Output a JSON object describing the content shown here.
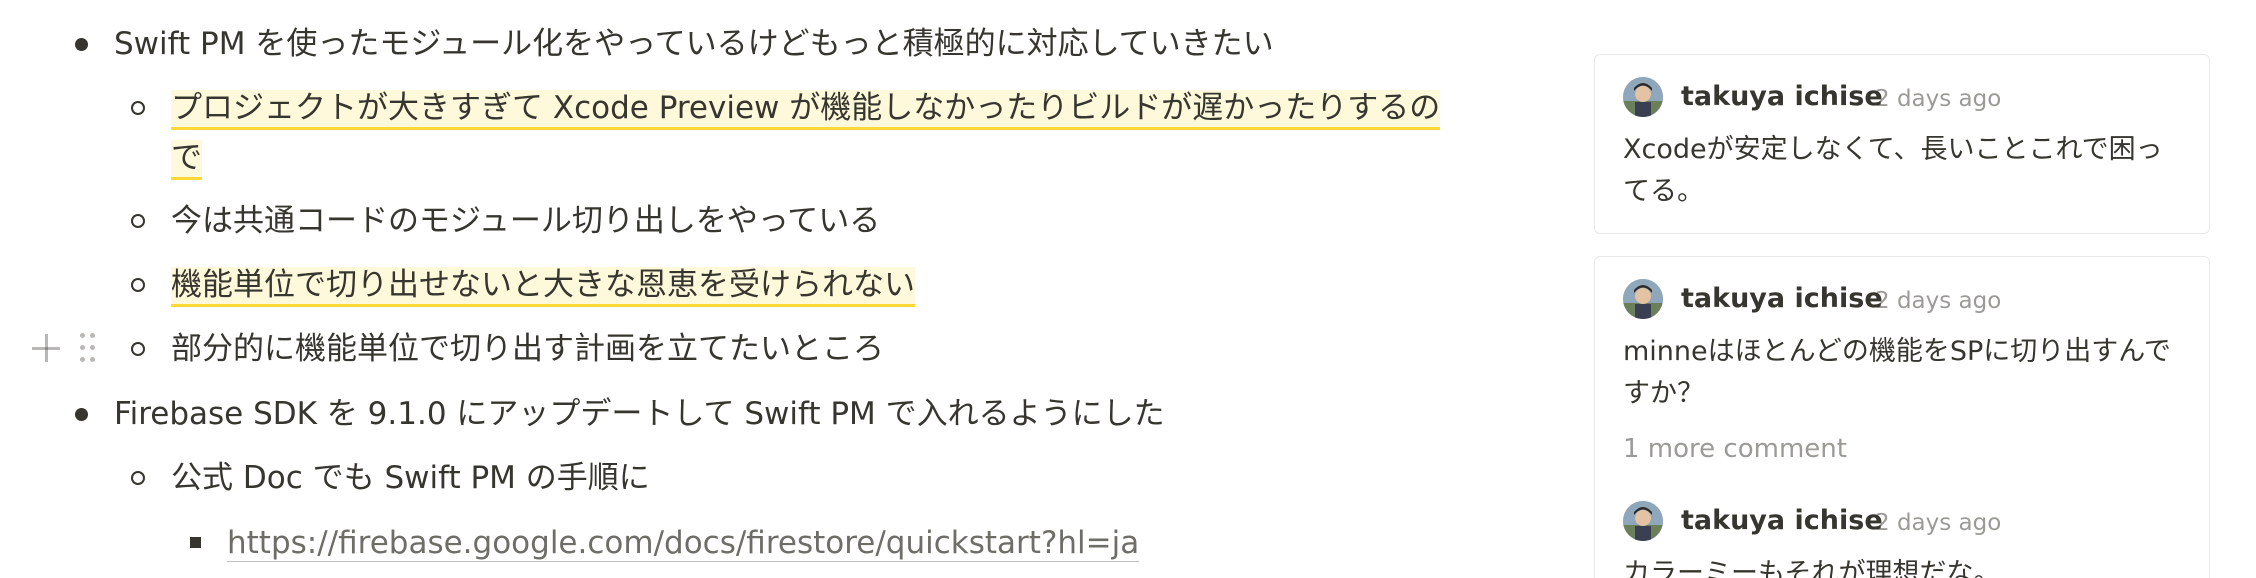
{
  "document": {
    "lines": [
      {
        "text": "Swift PM を使ったモジュール化をやっているけどもっと積極的に対応していきたい",
        "level": 1
      },
      {
        "text": "プロジェクトが大きすぎて Xcode Preview が機能しなかったりビルドが遅かったりするの",
        "level": 2,
        "highlight": true
      },
      {
        "text": "で",
        "level": 2,
        "highlight": true,
        "continuation": true
      },
      {
        "text": "今は共通コードのモジュール切り出しをやっている",
        "level": 2
      },
      {
        "text": "機能単位で切り出せないと大きな恩恵を受けられない",
        "level": 2,
        "highlight": true
      },
      {
        "text": "部分的に機能単位で切り出す計画を立てたいところ",
        "level": 2
      },
      {
        "text": "Firebase SDK を 9.1.0 にアップデートして Swift PM で入れるようにした",
        "level": 1
      },
      {
        "text": "公式 Doc でも Swift PM の手順に",
        "level": 2
      },
      {
        "text": "https://firebase.google.com/docs/firestore/quickstart?hl=ja",
        "level": 3,
        "link": true
      }
    ],
    "block_handle_icons": [
      "plus-icon",
      "drag-handle-icon"
    ]
  },
  "comments": {
    "threads": [
      {
        "comments": [
          {
            "author": "takuya ichise",
            "time": "2 days ago",
            "body": "Xcodeが安定しなくて、長いことこれで困ってる。"
          }
        ]
      },
      {
        "comments": [
          {
            "author": "takuya ichise",
            "time": "2 days ago",
            "body": "minneはほとんどの機能をSPに切り出すんですか？"
          },
          {
            "author": "takuya ichise",
            "time": "2 days ago",
            "body": "カラーミーもそれが理想だな。"
          }
        ],
        "more_label": "1 more comment"
      }
    ]
  },
  "colors": {
    "text": "#37352f",
    "highlight_bg": "#fff7d6",
    "highlight_underline": "#ffcb00",
    "muted": "#9b9a97",
    "card_border": "#e9e9e7"
  }
}
